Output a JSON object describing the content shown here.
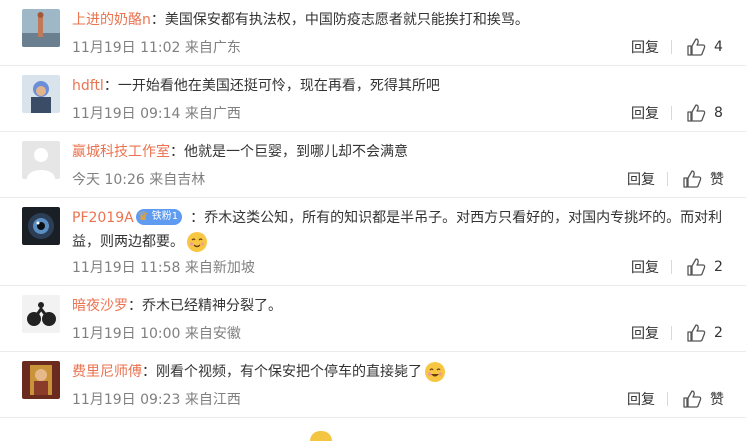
{
  "comments": [
    {
      "user": "上进的奶酪n",
      "text": "美国保安都有执法权，中国防疫志愿者就只能挨打和挨骂。",
      "time": "11月19日 11:02",
      "location": "来自广东",
      "reply": "回复",
      "likes": "4"
    },
    {
      "user": "hdftl",
      "text": "一开始看他在美国还挺可怜，现在再看，死得其所吧",
      "time": "11月19日 09:14",
      "location": "来自广西",
      "reply": "回复",
      "likes": "8"
    },
    {
      "user": "赢城科技工作室",
      "text": "他就是一个巨婴，到哪儿却不会满意",
      "time": "今天 10:26",
      "location": "来自吉林",
      "reply": "回复",
      "likes": "赞"
    },
    {
      "user": "PF2019A",
      "badge": "铁粉1",
      "text": "乔木这类公知，所有的知识都是半吊子。对西方只看好的，对国内专挑坏的。而对利益，则两边都要。",
      "time": "11月19日 11:58",
      "location": "来自新加坡",
      "reply": "回复",
      "likes": "2"
    },
    {
      "user": "暗夜沙罗",
      "text": "乔木已经精神分裂了。",
      "time": "11月19日 10:00",
      "location": "来自安徽",
      "reply": "回复",
      "likes": "2"
    },
    {
      "user": "费里尼师傅",
      "text": "刚看个视频，有个保安把个停车的直接毙了",
      "time": "11月19日 09:23",
      "location": "来自江西",
      "reply": "回复",
      "likes": "赞"
    }
  ],
  "colors": {
    "username": "#eb7350",
    "meta": "#808080",
    "badge": "#5e9bf1"
  },
  "icons": {
    "like": "thumbs-up-icon",
    "badge": "crown-icon",
    "emoji": "grin-emoji-icon"
  }
}
